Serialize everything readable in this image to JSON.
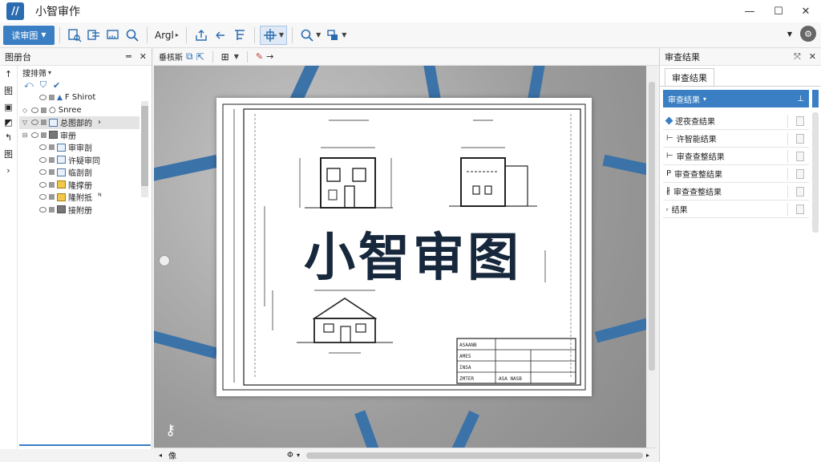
{
  "app": {
    "title": "小智审作",
    "logo_text": "//"
  },
  "window_controls": {
    "minimize": "—",
    "maximize": "☐",
    "close": "✕"
  },
  "toolbar": {
    "primary_label": "读审图",
    "font_label": "Argl",
    "buttons": [
      "zoom-page",
      "layers-tool",
      "measure-tool",
      "search-tool",
      "export-tool",
      "undo-tool",
      "align-tool",
      "pan-tool",
      "zoom-tool",
      "more-tool"
    ]
  },
  "left_panel": {
    "title": "图册台",
    "filter_label": "搜排筛",
    "side_tools": [
      "↑",
      "图",
      "▣",
      "◩",
      "↰",
      "图",
      "›"
    ],
    "tree": [
      {
        "label": "F Shirot",
        "toggle": "",
        "icon": "triangle",
        "indent": 1
      },
      {
        "label": "Snree",
        "toggle": "◇",
        "icon": "circle",
        "indent": 0
      },
      {
        "label": "总图部的",
        "toggle": "▽",
        "icon": "layer",
        "indent": 0,
        "selected": true,
        "suffix": "›"
      },
      {
        "label": "审册",
        "toggle": "⊟",
        "icon": "gray",
        "indent": 0
      },
      {
        "label": "审审剖",
        "toggle": "",
        "icon": "layer",
        "indent": 1
      },
      {
        "label": "许疑审同",
        "toggle": "",
        "icon": "layer",
        "indent": 1
      },
      {
        "label": "临剖剖",
        "toggle": "",
        "icon": "layer",
        "indent": 1
      },
      {
        "label": "隆撑册",
        "toggle": "",
        "icon": "yellow",
        "indent": 1
      },
      {
        "label": "隆附抵",
        "toggle": "",
        "icon": "yellow",
        "indent": 1,
        "suffix": "ᴺ"
      },
      {
        "label": "接附册",
        "toggle": "",
        "icon": "gray",
        "indent": 1
      }
    ]
  },
  "view_toolbar": {
    "label": "垂核斯"
  },
  "canvas": {
    "watermark": "小智审图",
    "title_block": [
      "ASAANB",
      "AMES",
      "INSA",
      "ZMTER",
      "ASA NASB"
    ]
  },
  "status": {
    "left_label": "像",
    "mid_label": "Φ"
  },
  "right_panel": {
    "title": "审查结果",
    "tab_label": "审查结果",
    "dropdown_label": "审查结果",
    "pin": "⊥",
    "items": [
      {
        "label": "逻夜查结果",
        "marker": "diamond"
      },
      {
        "label": "许智能结果",
        "marker": "⊢"
      },
      {
        "label": "审查查整结果",
        "marker": "⊢"
      },
      {
        "label": "审查查整结果",
        "marker": "P"
      },
      {
        "label": "审查查整结果",
        "marker": "∦"
      },
      {
        "label": "结果",
        "marker": "ᵣ"
      }
    ]
  }
}
